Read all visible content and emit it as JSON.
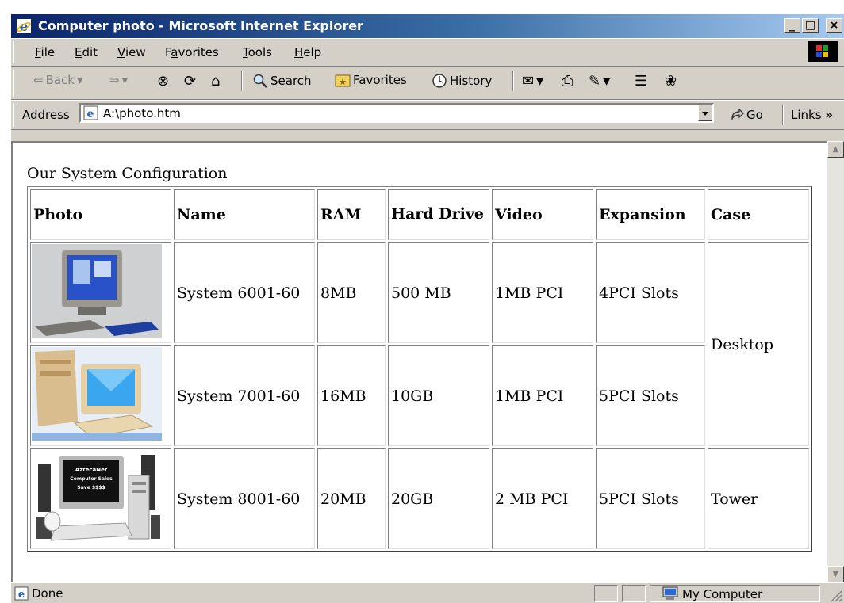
{
  "window": {
    "title": "Computer photo - Microsoft Internet Explorer",
    "controls": {
      "minimize": "_",
      "restore": "□",
      "close": "×"
    }
  },
  "menu": {
    "items": [
      {
        "prefix": "",
        "u": "F",
        "rest": "ile"
      },
      {
        "prefix": "",
        "u": "E",
        "rest": "dit"
      },
      {
        "prefix": "",
        "u": "V",
        "rest": "iew"
      },
      {
        "prefix": "F",
        "u": "a",
        "rest": "vorites"
      },
      {
        "prefix": "",
        "u": "T",
        "rest": "ools"
      },
      {
        "prefix": "",
        "u": "H",
        "rest": "elp"
      }
    ]
  },
  "toolbar": {
    "back": "Back",
    "search": "Search",
    "favorites": "Favorites",
    "history": "History",
    "back_arrow": "⇐",
    "forward_arrow": "⇒",
    "dropdown": "▾",
    "stop": "⊗",
    "refresh": "⟳",
    "home": "⌂",
    "mail": "✉",
    "print": "⎙",
    "edit": "✎",
    "discuss": "☰",
    "messenger": "❀"
  },
  "address": {
    "label_u": "d",
    "label_pre": "A",
    "label_post": "dress",
    "value": "A:\\photo.htm",
    "go": "Go",
    "links": "Links",
    "links_chevron": "»"
  },
  "page": {
    "caption": "Our System Configuration",
    "table": {
      "headers": [
        "Photo",
        "Name",
        "RAM",
        "Hard Drive",
        "Video",
        "Expansion",
        "Case"
      ],
      "rows": [
        {
          "name": "System 6001-60",
          "ram": "8MB",
          "hdd": "500 MB",
          "video": "1MB PCI",
          "expansion": "4PCI Slots"
        },
        {
          "name": "System 7001-60",
          "ram": "16MB",
          "hdd": "10GB",
          "video": "1MB PCI",
          "expansion": "5PCI Slots"
        },
        {
          "name": "System 8001-60",
          "ram": "20MB",
          "hdd": "20GB",
          "video": "2 MB PCI",
          "expansion": "5PCI Slots"
        }
      ],
      "case_desktop": "Desktop",
      "case_tower": "Tower",
      "monitor_text": [
        "AztecaNet",
        "Computer Sales",
        "Save $$$$"
      ]
    }
  },
  "status": {
    "text": "Done",
    "zone": "My Computer"
  },
  "colors": {
    "titlebar_start": "#0a246a",
    "titlebar_end": "#a6caf0",
    "chrome": "#d4d0c8"
  }
}
